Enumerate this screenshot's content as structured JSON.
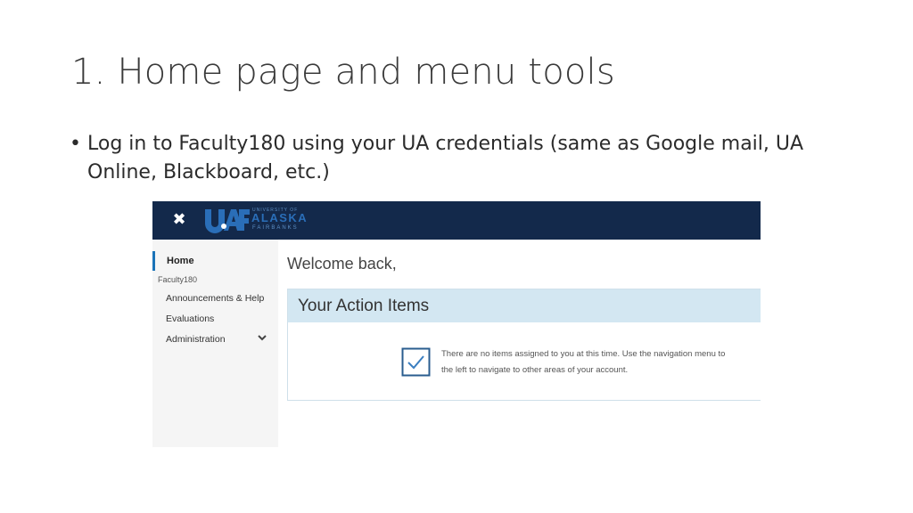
{
  "slide": {
    "title": "1.  Home page and menu tools",
    "bullet_marker": "•",
    "bullet_text": "Log in to Faculty180 using your UA credentials (same as Google mail, UA Online, Blackboard, etc.)"
  },
  "app": {
    "topbar": {
      "close_glyph": "✖",
      "logo": {
        "mark": "UAF",
        "line_top": "UNIVERSITY OF",
        "line_mid": "ALASKA",
        "line_bot": "FAIRBANKS"
      }
    },
    "sidebar": {
      "home_label": "Home",
      "section_label": "Faculty180",
      "items": [
        {
          "label": "Announcements & Help"
        },
        {
          "label": "Evaluations"
        },
        {
          "label": "Administration"
        }
      ]
    },
    "main": {
      "welcome": "Welcome back,",
      "action_card": {
        "title": "Your Action Items",
        "message": "There are no items assigned to you at this time. Use the navigation menu to the left to navigate to other areas of your account."
      }
    },
    "colors": {
      "topbar": "#13294b",
      "accent": "#1a73b8",
      "card_header": "#d3e7f2"
    },
    "icons": [
      "close-icon",
      "uaf-logo",
      "chevron-down-icon",
      "checkbox-check-icon"
    ]
  }
}
